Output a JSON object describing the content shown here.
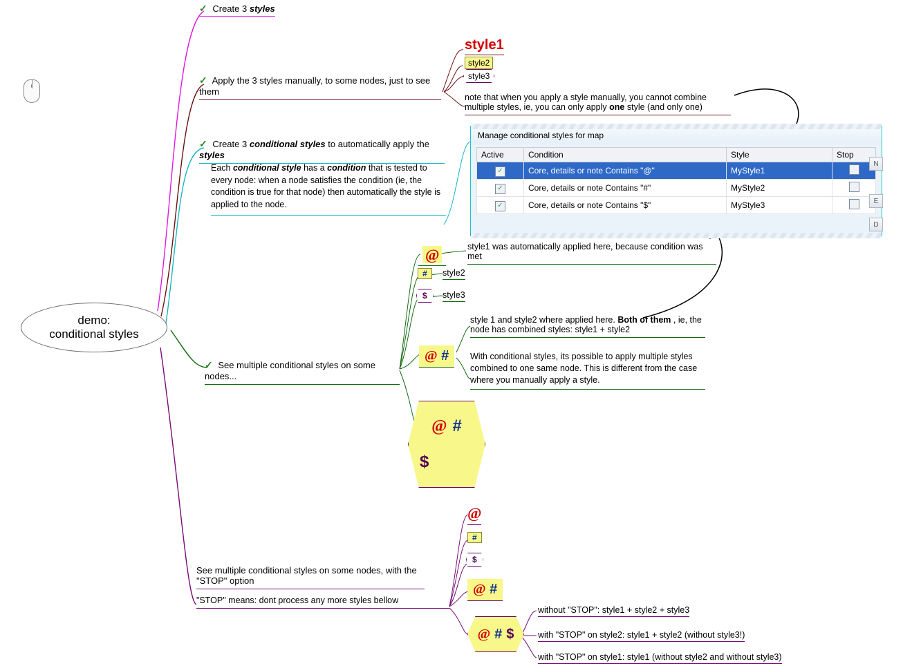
{
  "root": {
    "line1": "demo:",
    "line2": "conditional styles"
  },
  "b1": {
    "label_prefix": "Create 3 ",
    "styles_word": "styles"
  },
  "b2": {
    "label": "Apply the 3 styles manually, to some nodes, just to see them",
    "style1": "style1",
    "style2": "style2",
    "style3": "style3",
    "note_a": "note that when you apply a style manually, you cannot combine multiple styles, ie, you can only apply ",
    "one": "one",
    "note_b": " style (and only one)"
  },
  "b3": {
    "label_a": "Create 3 ",
    "cond_styles": "conditional styles",
    "label_b": " to automatically apply the ",
    "styles": "styles",
    "desc_a": "Each ",
    "desc_cs": "conditional style",
    "desc_b": " has a ",
    "desc_cond": "condition",
    "desc_c": " that is tested to every node: when a node satisfies the condition (ie, the condition is true for that node) then automatically the style is applied to the node."
  },
  "dialog": {
    "title": "Manage conditional styles for map",
    "header": {
      "active": "Active",
      "condition": "Condition",
      "style": "Style",
      "stop": "Stop"
    },
    "rows": [
      {
        "active": true,
        "condition": "Core, details or note Contains \"@\"",
        "style": "MyStyle1",
        "stop": false
      },
      {
        "active": true,
        "condition": "Core, details or note Contains \"#\"",
        "style": "MyStyle2",
        "stop": false
      },
      {
        "active": true,
        "condition": "Core, details or note Contains \"$\"",
        "style": "MyStyle3",
        "stop": false
      }
    ],
    "sidebtns": {
      "n": "N",
      "e": "E",
      "d": "D"
    }
  },
  "b4": {
    "label": "See multiple conditional styles on some nodes...",
    "at": "@",
    "hash": "#",
    "dollar": "$",
    "style2": "style2",
    "style3": "style3",
    "note1": "style1 was automatically applied here, because condition was met",
    "both_a": "style 1 and style2 where applied here. ",
    "both_bold": "Both of them",
    "both_b": ", ie, the node has combined styles: style1 + style2",
    "combined": "@ #",
    "detail": "With conditional styles, its possible to apply multiple styles combined to one same node. This is different from the case where you manually apply a style.",
    "big": "@ # $"
  },
  "b5": {
    "label": "See multiple conditional styles on some nodes, with the \"STOP\"  option",
    "note": "\"STOP\" means: dont process any more styles bellow",
    "at": "@",
    "hash": "#",
    "dollar": "$",
    "combined_small": "@ #",
    "combined_big": "@ # $",
    "r1": "without \"STOP\": style1 + style2 + style3",
    "r2": "with \"STOP\" on style2: style1 + style2 (without style3!)",
    "r3": "with \"STOP\" on style1: style1 (without style2 and without style3)"
  }
}
